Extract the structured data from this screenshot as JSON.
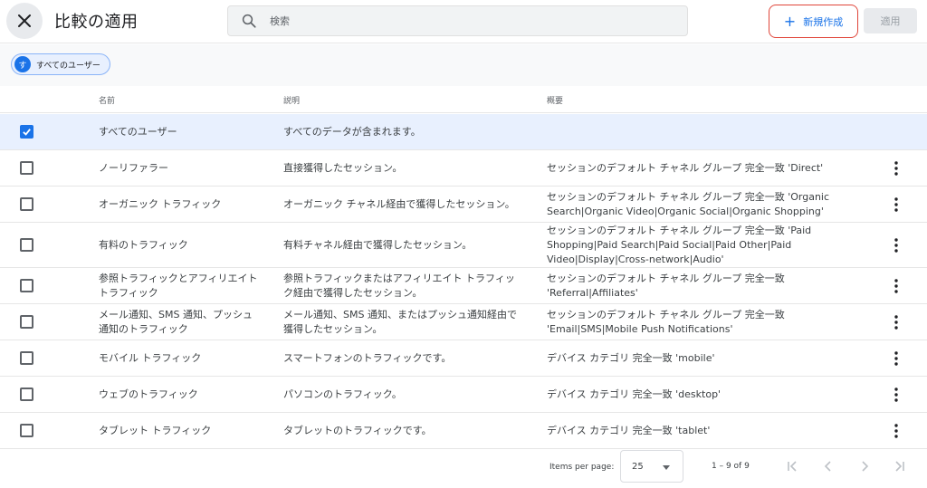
{
  "header": {
    "title": "比較の適用",
    "search_placeholder": "検索",
    "new_label": "新規作成",
    "apply_label": "適用"
  },
  "chip": {
    "avatar": "す",
    "label": "すべてのユーザー"
  },
  "table": {
    "columns": [
      "名前",
      "説明",
      "概要"
    ],
    "rows": [
      {
        "name": "すべてのユーザー",
        "description": "すべてのデータが含まれます。",
        "summary": "",
        "checked": true
      },
      {
        "name": "ノーリファラー",
        "description": "直接獲得したセッション。",
        "summary": "セッションのデフォルト チャネル グループ 完全一致 'Direct'",
        "checked": false
      },
      {
        "name": "オーガニック トラフィック",
        "description": "オーガニック チャネル経由で獲得したセッション。",
        "summary": "セッションのデフォルト チャネル グループ 完全一致 'Organic Search|Organic Video|Organic Social|Organic Shopping'",
        "checked": false
      },
      {
        "name": "有料のトラフィック",
        "description": "有料チャネル経由で獲得したセッション。",
        "summary": "セッションのデフォルト チャネル グループ 完全一致 'Paid Shopping|Paid Search|Paid Social|Paid Other|Paid Video|Display|Cross-network|Audio'",
        "checked": false
      },
      {
        "name": "参照トラフィックとアフィリエイト トラフィック",
        "description": "参照トラフィックまたはアフィリエイト トラフィック経由で獲得したセッション。",
        "summary": "セッションのデフォルト チャネル グループ 完全一致 'Referral|Affiliates'",
        "checked": false
      },
      {
        "name": "メール通知、SMS 通知、プッシュ通知のトラフィック",
        "description": "メール通知、SMS 通知、またはプッシュ通知経由で獲得したセッション。",
        "summary": "セッションのデフォルト チャネル グループ 完全一致 'Email|SMS|Mobile Push Notifications'",
        "checked": false
      },
      {
        "name": "モバイル トラフィック",
        "description": "スマートフォンのトラフィックです。",
        "summary": "デバイス カテゴリ 完全一致 'mobile'",
        "checked": false
      },
      {
        "name": "ウェブのトラフィック",
        "description": "パソコンのトラフィック。",
        "summary": "デバイス カテゴリ 完全一致 'desktop'",
        "checked": false
      },
      {
        "name": "タブレット トラフィック",
        "description": "タブレットのトラフィックです。",
        "summary": "デバイス カテゴリ 完全一致 'tablet'",
        "checked": false
      }
    ]
  },
  "pagination": {
    "items_per_page_label": "Items per page:",
    "items_per_page_value": "25",
    "range_label": "1 – 9 of 9"
  },
  "colors": {
    "accent": "#1a73e8",
    "highlight_border": "#e0463a",
    "selected_row": "#e8f0fe"
  }
}
